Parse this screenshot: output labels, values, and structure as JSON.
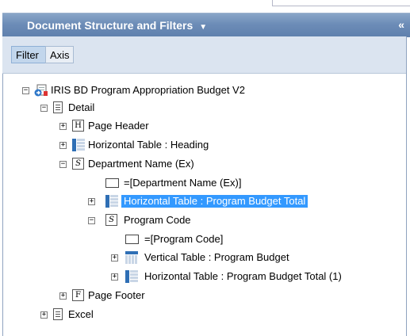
{
  "panel": {
    "title": "Document Structure and Filters",
    "title_arrow": "▼",
    "collapse_glyph": "«"
  },
  "toolbar": {
    "filter_label": "Filter",
    "axis_label": "Axis"
  },
  "tree": {
    "root": "IRIS BD Program Appropriation Budget V2",
    "detail": "Detail",
    "page_header": "Page Header",
    "page_header_icon": "H",
    "htable_heading": "Horizontal Table : Heading",
    "dept_section": "Department Name (Ex)",
    "section_icon": "S",
    "dept_cell": "=[Department Name (Ex)]",
    "htable_program_budget_total": "Horizontal Table : Program Budget Total",
    "program_code_section": "Program Code",
    "program_code_cell": "=[Program Code]",
    "vtable_program_budget": "Vertical Table : Program Budget",
    "htable_program_budget_total_1": "Horizontal Table : Program Budget Total (1)",
    "page_footer": "Page Footer",
    "page_footer_icon": "F",
    "excel": "Excel",
    "expand_glyph": "+",
    "collapse_glyph": "−"
  }
}
